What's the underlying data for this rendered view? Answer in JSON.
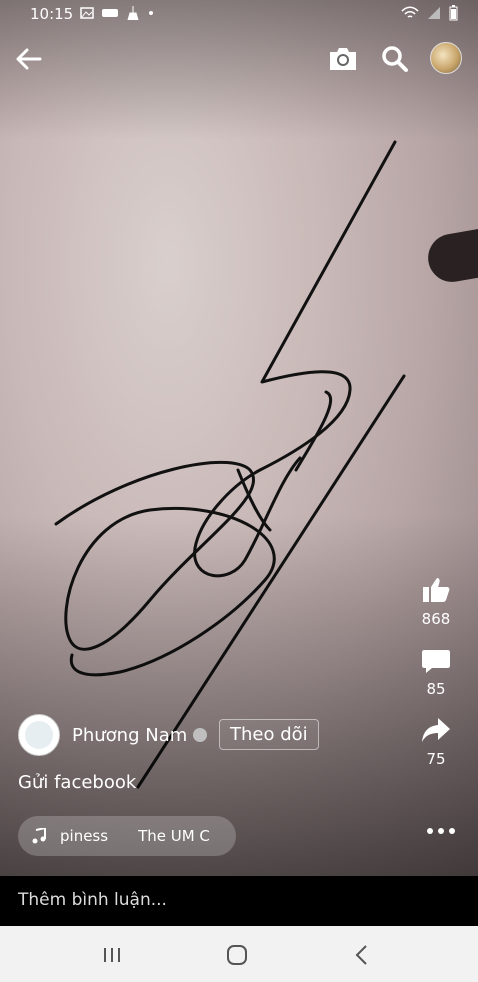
{
  "status": {
    "time": "10:15"
  },
  "author": {
    "name": "Phương Nam"
  },
  "follow_label": "Theo dõi",
  "caption": "Gửi facebook",
  "music": {
    "track_left": "piness",
    "track_right": "The UM C"
  },
  "stats": {
    "likes": "868",
    "comments": "85",
    "shares": "75"
  },
  "comment_placeholder": "Thêm bình luận...",
  "colors": {
    "background_wall": "#c9b9b8",
    "ink": "#111111"
  }
}
